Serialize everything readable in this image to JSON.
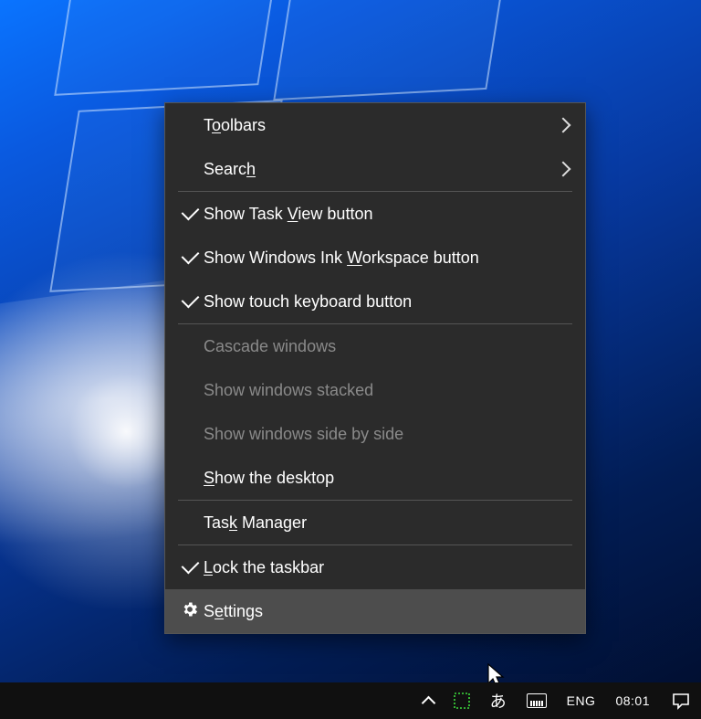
{
  "menu": {
    "items": [
      {
        "key": "toolbars",
        "pre": "T",
        "u": "o",
        "post": "olbars",
        "checked": false,
        "disabled": false,
        "submenu": true
      },
      {
        "key": "search",
        "pre": "Searc",
        "u": "h",
        "post": "",
        "checked": false,
        "disabled": false,
        "submenu": true
      },
      "sep",
      {
        "key": "taskview",
        "pre": "Show Task ",
        "u": "V",
        "post": "iew button",
        "checked": true,
        "disabled": false,
        "submenu": false
      },
      {
        "key": "ink",
        "pre": "Show Windows Ink ",
        "u": "W",
        "post": "orkspace button",
        "checked": true,
        "disabled": false,
        "submenu": false
      },
      {
        "key": "touchkb",
        "pre": "Show touch keyboard button",
        "u": "",
        "post": "",
        "checked": true,
        "disabled": false,
        "submenu": false
      },
      "sep",
      {
        "key": "cascade",
        "pre": "Cascade windows",
        "u": "",
        "post": "",
        "checked": false,
        "disabled": true,
        "submenu": false
      },
      {
        "key": "stacked",
        "pre": "Show windows stacked",
        "u": "",
        "post": "",
        "checked": false,
        "disabled": true,
        "submenu": false
      },
      {
        "key": "sidebyside",
        "pre": "Show windows side by side",
        "u": "",
        "post": "",
        "checked": false,
        "disabled": true,
        "submenu": false
      },
      {
        "key": "showdesktop",
        "pre": "",
        "u": "S",
        "post": "how the desktop",
        "checked": false,
        "disabled": false,
        "submenu": false
      },
      "sep",
      {
        "key": "taskmgr",
        "pre": "Tas",
        "u": "k",
        "post": " Manager",
        "checked": false,
        "disabled": false,
        "submenu": false
      },
      "sep",
      {
        "key": "lock",
        "pre": "",
        "u": "L",
        "post": "ock the taskbar",
        "checked": true,
        "disabled": false,
        "submenu": false
      },
      {
        "key": "settings",
        "pre": "S",
        "u": "e",
        "post": "ttings",
        "checked": false,
        "disabled": false,
        "submenu": false,
        "icon": "gear",
        "hover": true
      }
    ]
  },
  "tray": {
    "ime_hint": "あ",
    "language": "ENG",
    "clock": "08:01"
  }
}
